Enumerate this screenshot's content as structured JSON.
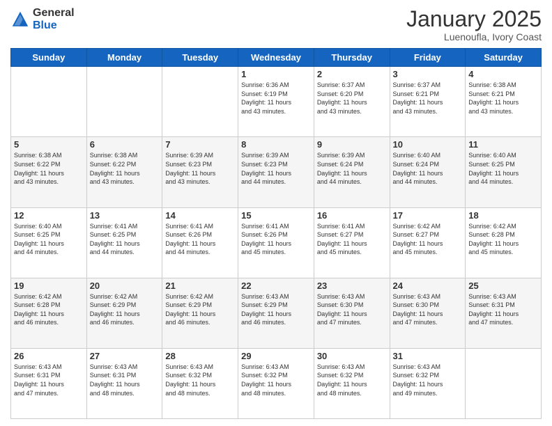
{
  "header": {
    "logo_general": "General",
    "logo_blue": "Blue",
    "month_year": "January 2025",
    "location": "Luenoufla, Ivory Coast"
  },
  "weekdays": [
    "Sunday",
    "Monday",
    "Tuesday",
    "Wednesday",
    "Thursday",
    "Friday",
    "Saturday"
  ],
  "weeks": [
    [
      {
        "day": "",
        "info": ""
      },
      {
        "day": "",
        "info": ""
      },
      {
        "day": "",
        "info": ""
      },
      {
        "day": "1",
        "info": "Sunrise: 6:36 AM\nSunset: 6:19 PM\nDaylight: 11 hours\nand 43 minutes."
      },
      {
        "day": "2",
        "info": "Sunrise: 6:37 AM\nSunset: 6:20 PM\nDaylight: 11 hours\nand 43 minutes."
      },
      {
        "day": "3",
        "info": "Sunrise: 6:37 AM\nSunset: 6:21 PM\nDaylight: 11 hours\nand 43 minutes."
      },
      {
        "day": "4",
        "info": "Sunrise: 6:38 AM\nSunset: 6:21 PM\nDaylight: 11 hours\nand 43 minutes."
      }
    ],
    [
      {
        "day": "5",
        "info": "Sunrise: 6:38 AM\nSunset: 6:22 PM\nDaylight: 11 hours\nand 43 minutes."
      },
      {
        "day": "6",
        "info": "Sunrise: 6:38 AM\nSunset: 6:22 PM\nDaylight: 11 hours\nand 43 minutes."
      },
      {
        "day": "7",
        "info": "Sunrise: 6:39 AM\nSunset: 6:23 PM\nDaylight: 11 hours\nand 43 minutes."
      },
      {
        "day": "8",
        "info": "Sunrise: 6:39 AM\nSunset: 6:23 PM\nDaylight: 11 hours\nand 44 minutes."
      },
      {
        "day": "9",
        "info": "Sunrise: 6:39 AM\nSunset: 6:24 PM\nDaylight: 11 hours\nand 44 minutes."
      },
      {
        "day": "10",
        "info": "Sunrise: 6:40 AM\nSunset: 6:24 PM\nDaylight: 11 hours\nand 44 minutes."
      },
      {
        "day": "11",
        "info": "Sunrise: 6:40 AM\nSunset: 6:25 PM\nDaylight: 11 hours\nand 44 minutes."
      }
    ],
    [
      {
        "day": "12",
        "info": "Sunrise: 6:40 AM\nSunset: 6:25 PM\nDaylight: 11 hours\nand 44 minutes."
      },
      {
        "day": "13",
        "info": "Sunrise: 6:41 AM\nSunset: 6:25 PM\nDaylight: 11 hours\nand 44 minutes."
      },
      {
        "day": "14",
        "info": "Sunrise: 6:41 AM\nSunset: 6:26 PM\nDaylight: 11 hours\nand 44 minutes."
      },
      {
        "day": "15",
        "info": "Sunrise: 6:41 AM\nSunset: 6:26 PM\nDaylight: 11 hours\nand 45 minutes."
      },
      {
        "day": "16",
        "info": "Sunrise: 6:41 AM\nSunset: 6:27 PM\nDaylight: 11 hours\nand 45 minutes."
      },
      {
        "day": "17",
        "info": "Sunrise: 6:42 AM\nSunset: 6:27 PM\nDaylight: 11 hours\nand 45 minutes."
      },
      {
        "day": "18",
        "info": "Sunrise: 6:42 AM\nSunset: 6:28 PM\nDaylight: 11 hours\nand 45 minutes."
      }
    ],
    [
      {
        "day": "19",
        "info": "Sunrise: 6:42 AM\nSunset: 6:28 PM\nDaylight: 11 hours\nand 46 minutes."
      },
      {
        "day": "20",
        "info": "Sunrise: 6:42 AM\nSunset: 6:29 PM\nDaylight: 11 hours\nand 46 minutes."
      },
      {
        "day": "21",
        "info": "Sunrise: 6:42 AM\nSunset: 6:29 PM\nDaylight: 11 hours\nand 46 minutes."
      },
      {
        "day": "22",
        "info": "Sunrise: 6:43 AM\nSunset: 6:29 PM\nDaylight: 11 hours\nand 46 minutes."
      },
      {
        "day": "23",
        "info": "Sunrise: 6:43 AM\nSunset: 6:30 PM\nDaylight: 11 hours\nand 47 minutes."
      },
      {
        "day": "24",
        "info": "Sunrise: 6:43 AM\nSunset: 6:30 PM\nDaylight: 11 hours\nand 47 minutes."
      },
      {
        "day": "25",
        "info": "Sunrise: 6:43 AM\nSunset: 6:31 PM\nDaylight: 11 hours\nand 47 minutes."
      }
    ],
    [
      {
        "day": "26",
        "info": "Sunrise: 6:43 AM\nSunset: 6:31 PM\nDaylight: 11 hours\nand 47 minutes."
      },
      {
        "day": "27",
        "info": "Sunrise: 6:43 AM\nSunset: 6:31 PM\nDaylight: 11 hours\nand 48 minutes."
      },
      {
        "day": "28",
        "info": "Sunrise: 6:43 AM\nSunset: 6:32 PM\nDaylight: 11 hours\nand 48 minutes."
      },
      {
        "day": "29",
        "info": "Sunrise: 6:43 AM\nSunset: 6:32 PM\nDaylight: 11 hours\nand 48 minutes."
      },
      {
        "day": "30",
        "info": "Sunrise: 6:43 AM\nSunset: 6:32 PM\nDaylight: 11 hours\nand 48 minutes."
      },
      {
        "day": "31",
        "info": "Sunrise: 6:43 AM\nSunset: 6:32 PM\nDaylight: 11 hours\nand 49 minutes."
      },
      {
        "day": "",
        "info": ""
      }
    ]
  ]
}
